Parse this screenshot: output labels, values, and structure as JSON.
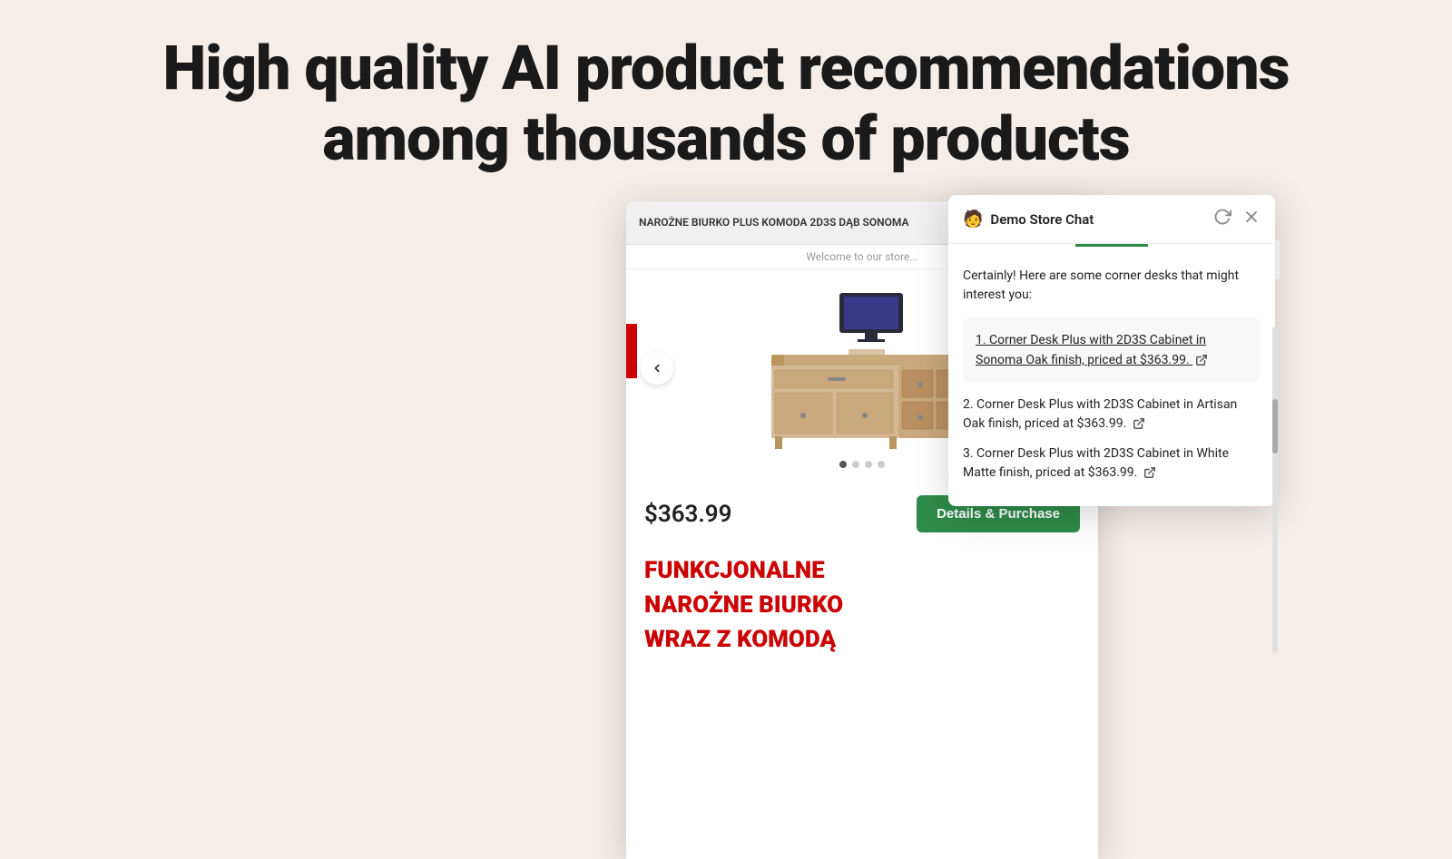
{
  "page": {
    "background_color": "#f5ede8"
  },
  "hero": {
    "line1": "High quality AI product recommendations",
    "line2": "among thousands of products"
  },
  "browser": {
    "title": "NAROŻNE BIURKO PLUS KOMODA 2D3S DĄB SONOMA",
    "icons": {
      "external_link": "⤢",
      "expand": "⛶",
      "close": "✕"
    },
    "store_hint": "Welcome to our store...",
    "nav_arrows": {
      "left": "◀",
      "right": "▶"
    },
    "dots": [
      {
        "active": true
      },
      {
        "active": false
      },
      {
        "active": false
      },
      {
        "active": false
      }
    ],
    "price": "$363.99",
    "purchase_button": "Details & Purchase",
    "product_text": {
      "line1": "FUNKCJONALNE",
      "line2": "NAROŻNE BIURKO",
      "line3": "WRAZ Z KOMODĄ"
    }
  },
  "store_nav": {
    "search_icon": "🔍",
    "cart_icon": "🛍"
  },
  "chat": {
    "header": {
      "emoji": "🧑",
      "title": "Demo Store Chat",
      "refresh_icon": "↻",
      "close_icon": "✕"
    },
    "message_intro": "Certainly! Here are some corner desks that might interest you:",
    "products": [
      {
        "number": "1.",
        "text": "Corner Desk Plus with 2D3S Cabinet in Sonoma Oak finish, priced at $363.99.",
        "highlighted": true,
        "has_link": true
      },
      {
        "number": "2.",
        "text": "Corner Desk Plus with 2D3S Cabinet in Artisan Oak finish, priced at $363.99.",
        "highlighted": false,
        "has_link": true
      },
      {
        "number": "3.",
        "text": "Corner Desk Plus with 2D3S Cabinet in White Matte finish, priced at $363.99.",
        "highlighted": false,
        "has_link": true
      }
    ]
  }
}
